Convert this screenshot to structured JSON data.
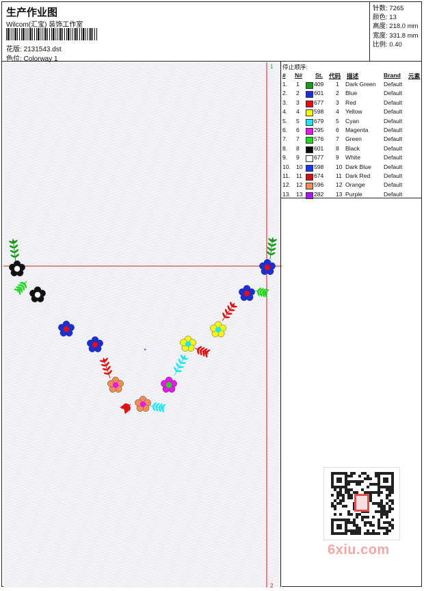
{
  "header": {
    "title": "生产作业图",
    "company": "Wilcom(汇宝) 装饰工作室",
    "design_label": "花版:",
    "design_value": "2131543.dst",
    "color_label": "色位:",
    "color_value": "Colorway 1"
  },
  "stats": [
    {
      "label": "针数:",
      "value": "7265"
    },
    {
      "label": "颜色:",
      "value": "13"
    },
    {
      "label": "高度:",
      "value": "218.0 mm"
    },
    {
      "label": "宽度:",
      "value": "331.8 mm"
    },
    {
      "label": "比例:",
      "value": "0.40"
    }
  ],
  "canvas": {
    "marker_top": "1",
    "marker_bottom": "2"
  },
  "color_table": {
    "title": "停止顺序:",
    "headers": [
      "#",
      "N#",
      "St.",
      "代码",
      "描述",
      "Brand",
      "元素"
    ],
    "rows": [
      {
        "n": "1.",
        "nn": "1",
        "color": "#1a9a1a",
        "st": "409",
        "code": "1",
        "desc": "Dark Green",
        "brand": "Default"
      },
      {
        "n": "2.",
        "nn": "2",
        "color": "#1a2fd6",
        "st": "601",
        "code": "2",
        "desc": "Blue",
        "brand": "Default"
      },
      {
        "n": "3.",
        "nn": "3",
        "color": "#e01010",
        "st": "677",
        "code": "3",
        "desc": "Red",
        "brand": "Default"
      },
      {
        "n": "4.",
        "nn": "4",
        "color": "#f5f51a",
        "st": "598",
        "code": "4",
        "desc": "Yellow",
        "brand": "Default"
      },
      {
        "n": "5.",
        "nn": "5",
        "color": "#22e6f0",
        "st": "679",
        "code": "5",
        "desc": "Cyan",
        "brand": "Default"
      },
      {
        "n": "6.",
        "nn": "6",
        "color": "#e61ae6",
        "st": "295",
        "code": "6",
        "desc": "Magenta",
        "brand": "Default"
      },
      {
        "n": "7.",
        "nn": "7",
        "color": "#22d622",
        "st": "576",
        "code": "7",
        "desc": "Green",
        "brand": "Default"
      },
      {
        "n": "8.",
        "nn": "8",
        "color": "#0a0a0a",
        "st": "601",
        "code": "8",
        "desc": "Black",
        "brand": "Default"
      },
      {
        "n": "9.",
        "nn": "9",
        "color": "#ffffff",
        "st": "677",
        "code": "9",
        "desc": "White",
        "brand": "Default"
      },
      {
        "n": "10.",
        "nn": "10",
        "color": "#1a36e6",
        "st": "598",
        "code": "10",
        "desc": "Dark Blue",
        "brand": "Default"
      },
      {
        "n": "11.",
        "nn": "11",
        "color": "#c81414",
        "st": "674",
        "code": "11",
        "desc": "Dark Red",
        "brand": "Default"
      },
      {
        "n": "12.",
        "nn": "12",
        "color": "#f08c5a",
        "st": "596",
        "code": "12",
        "desc": "Orange",
        "brand": "Default"
      },
      {
        "n": "13.",
        "nn": "13",
        "color": "#a51ae6",
        "st": "282",
        "code": "13",
        "desc": "Purple",
        "brand": "Default"
      }
    ]
  },
  "watermark": "6xiu.com"
}
